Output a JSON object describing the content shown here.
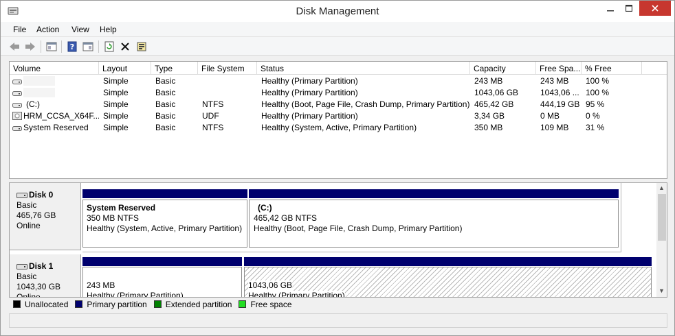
{
  "window": {
    "title": "Disk Management"
  },
  "menu": [
    "File",
    "Action",
    "View",
    "Help"
  ],
  "toolbar": [
    "back-icon",
    "forward-icon",
    "up-level-icon",
    "help-icon",
    "console-tree-icon",
    "refresh-icon",
    "delete-icon",
    "properties-icon"
  ],
  "columns": [
    "Volume",
    "Layout",
    "Type",
    "File System",
    "Status",
    "Capacity",
    "Free Spa...",
    "% Free"
  ],
  "volumes": [
    {
      "volume": "",
      "layout": "Simple",
      "type": "Basic",
      "fs": "",
      "status": "Healthy (Primary Partition)",
      "capacity": "243 MB",
      "free": "243 MB",
      "pct": "100 %"
    },
    {
      "volume": "",
      "layout": "Simple",
      "type": "Basic",
      "fs": "",
      "status": "Healthy (Primary Partition)",
      "capacity": "1043,06 GB",
      "free": "1043,06 ...",
      "pct": "100 %"
    },
    {
      "volume": "(C:)",
      "layout": "Simple",
      "type": "Basic",
      "fs": "NTFS",
      "status": "Healthy (Boot, Page File, Crash Dump, Primary Partition)",
      "capacity": "465,42 GB",
      "free": "444,19 GB",
      "pct": "95 %"
    },
    {
      "volume": "HRM_CCSA_X64F...",
      "layout": "Simple",
      "type": "Basic",
      "fs": "UDF",
      "status": "Healthy (Primary Partition)",
      "capacity": "3,34 GB",
      "free": "0 MB",
      "pct": "0 %"
    },
    {
      "volume": "System Reserved",
      "layout": "Simple",
      "type": "Basic",
      "fs": "NTFS",
      "status": "Healthy (System, Active, Primary Partition)",
      "capacity": "350 MB",
      "free": "109 MB",
      "pct": "31 %"
    }
  ],
  "disks": [
    {
      "name": "Disk 0",
      "type": "Basic",
      "size": "465,76 GB",
      "state": "Online",
      "partitions": [
        {
          "title": "System Reserved",
          "size": "350 MB NTFS",
          "status": "Healthy (System, Active, Primary Partition)"
        },
        {
          "title": "(C:)",
          "size": "465,42 GB NTFS",
          "status": "Healthy (Boot, Page File, Crash Dump, Primary Partition)"
        }
      ]
    },
    {
      "name": "Disk 1",
      "type": "Basic",
      "size": "1043,30 GB",
      "state": "Online",
      "partitions": [
        {
          "title": "",
          "size": "243 MB",
          "status": "Healthy (Primary Partition)"
        },
        {
          "title": "",
          "size": "1043,06 GB",
          "status": "Healthy (Primary Partition)"
        }
      ]
    }
  ],
  "legend": [
    {
      "label": "Unallocated",
      "color": "#000000"
    },
    {
      "label": "Primary partition",
      "color": "#00006e"
    },
    {
      "label": "Extended partition",
      "color": "#008000"
    },
    {
      "label": "Free space",
      "color": "#22dd22"
    }
  ]
}
